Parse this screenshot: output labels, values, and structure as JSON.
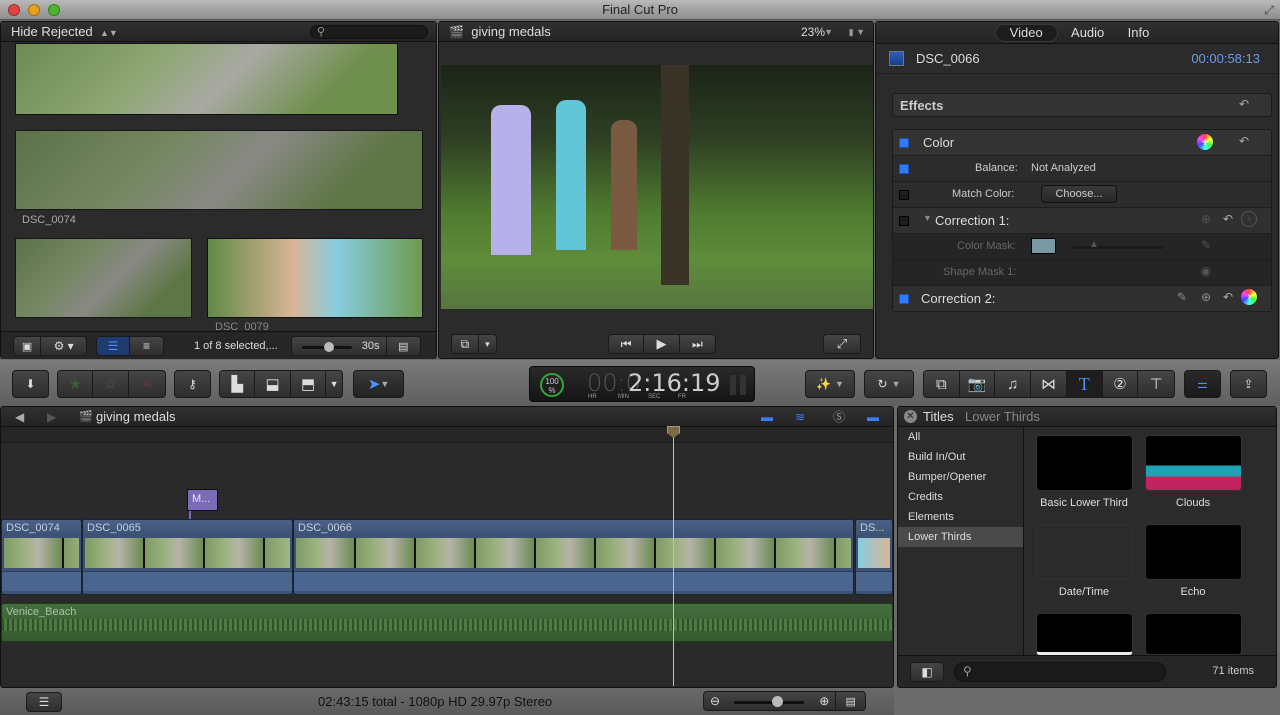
{
  "app": {
    "title": "Final Cut Pro"
  },
  "browser": {
    "filter": "Hide Rejected",
    "search_placeholder": "",
    "clip_labels": [
      "DSC_0074",
      "DSC_0079"
    ],
    "selection_status": "1 of 8 selected,...",
    "duration": "30s"
  },
  "viewer": {
    "project": "giving medals",
    "zoom": "23%"
  },
  "inspector": {
    "tabs": [
      "Video",
      "Audio",
      "Info"
    ],
    "active_tab": "Video",
    "clip_name": "DSC_0066",
    "timecode": "00:00:58:13",
    "effects_label": "Effects",
    "color_label": "Color",
    "balance_label": "Balance:",
    "balance_value": "Not Analyzed",
    "match_color_label": "Match Color:",
    "choose_button": "Choose...",
    "correction1": "Correction 1:",
    "color_mask": "Color Mask:",
    "shape_mask": "Shape Mask 1:",
    "correction2": "Correction 2:",
    "mask_color": "#7a9aa3"
  },
  "dashboard": {
    "percent": "100",
    "percent_sign": "%",
    "timecode_dim": "00:0",
    "timecode": "2:16:19",
    "units": [
      "HR",
      "MIN",
      "SEC",
      "FR"
    ]
  },
  "timeline": {
    "project": "giving medals",
    "marker": "M...",
    "clips": [
      "DSC_0074",
      "DSC_0065",
      "DSC_0066",
      "DS..."
    ],
    "audio_clip": "Venice_Beach",
    "status": "02:43:15 total - 1080p HD 29.97p Stereo"
  },
  "titles": {
    "heading": "Titles",
    "subheading": "Lower Thirds",
    "categories": [
      "All",
      "Build In/Out",
      "Bumper/Opener",
      "Credits",
      "Elements",
      "Lower Thirds"
    ],
    "selected_category": "Lower Thirds",
    "items": [
      "Basic Lower Third",
      "Clouds",
      "Date/Time",
      "Echo"
    ],
    "count": "71 items",
    "search_placeholder": ""
  },
  "colors": {
    "accent": "#2f7bff",
    "timecode_blue": "#6a9bea",
    "playhead": "#e8c24a",
    "marker": "#7a6ab8",
    "audio_green": "#3e6b3a"
  }
}
